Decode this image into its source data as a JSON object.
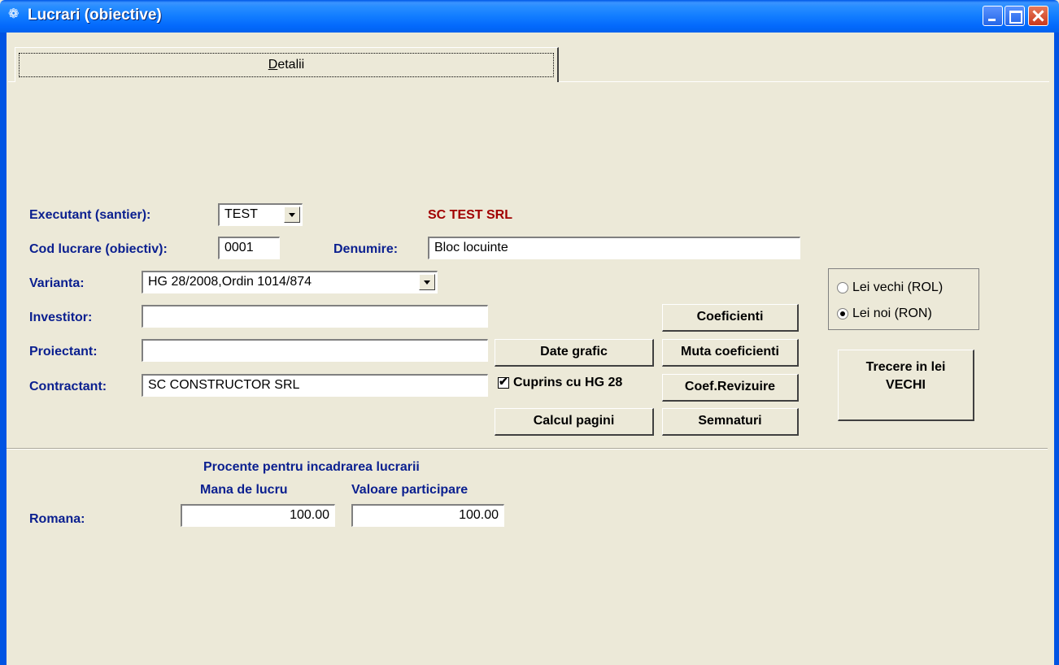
{
  "window": {
    "title": "Lucrari (obiective)"
  },
  "tab": {
    "label_prefix": "",
    "label_mnemonic": "D",
    "label_rest": "etalii"
  },
  "form": {
    "executant_label": "Executant (santier):",
    "executant_value": "TEST",
    "executant_name": "SC TEST SRL",
    "cod_label": "Cod lucrare (obiectiv):",
    "cod_value": "0001",
    "denumire_label": "Denumire:",
    "denumire_value": "Bloc locuinte",
    "varianta_label": "Varianta:",
    "varianta_value": "HG 28/2008,Ordin 1014/874",
    "investitor_label": "Investitor:",
    "investitor_value": "",
    "proiectant_label": "Proiectant:",
    "proiectant_value": "",
    "contractant_label": "Contractant:",
    "contractant_value": "SC CONSTRUCTOR SRL"
  },
  "buttons": {
    "coeficienti": "Coeficienti",
    "date_grafic": "Date grafic",
    "muta_coeficienti": "Muta coeficienti",
    "coef_revizuire": "Coef.Revizuire",
    "calcul_pagini": "Calcul pagini",
    "semnaturi": "Semnaturi",
    "trecere_line1": "Trecere in lei",
    "trecere_line2": "VECHI"
  },
  "checkbox": {
    "cuprins_label": "Cuprins cu HG 28",
    "checked": true
  },
  "currency": {
    "lei_vechi": "Lei vechi (ROL)",
    "lei_noi": "Lei noi (RON)",
    "selected": "lei_noi"
  },
  "percent": {
    "title": "Procente pentru incadrarea lucrarii",
    "mana_label": "Mana de lucru",
    "valoare_label": "Valoare participare",
    "romana_label": "Romana:",
    "mana_value": "100.00",
    "valoare_value": "100.00"
  }
}
